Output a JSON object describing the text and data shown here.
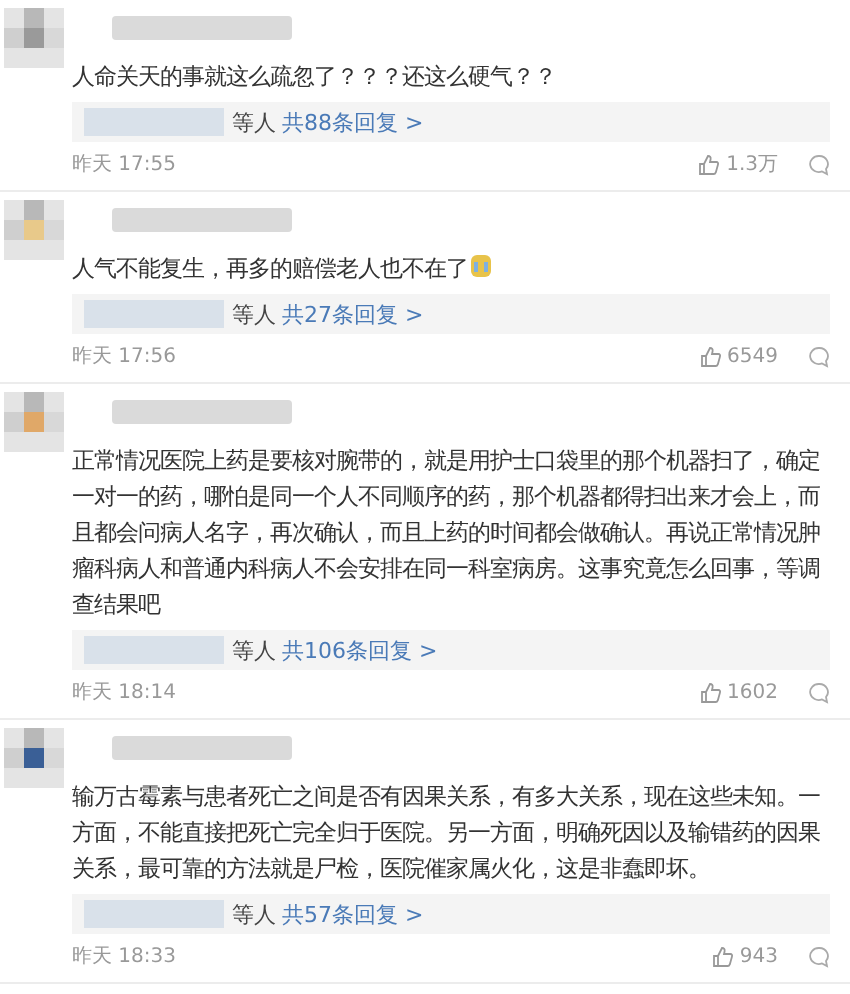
{
  "comments": [
    {
      "text": "人命关天的事就这么疏忽了？？？还这么硬气？？",
      "emoji": false,
      "reply_suffix": "等人",
      "reply_link": "共88条回复 >",
      "time": "昨天 17:55",
      "likes": "1.3万"
    },
    {
      "text": "人气不能复生，再多的赔偿老人也不在了",
      "emoji": true,
      "reply_suffix": "等人",
      "reply_link": "共27条回复 >",
      "time": "昨天 17:56",
      "likes": "6549"
    },
    {
      "text": "正常情况医院上药是要核对腕带的，就是用护士口袋里的那个机器扫了，确定一对一的药，哪怕是同一个人不同顺序的药，那个机器都得扫出来才会上，而且都会问病人名字，再次确认，而且上药的时间都会做确认。再说正常情况肿瘤科病人和普通内科病人不会安排在同一科室病房。这事究竟怎么回事，等调查结果吧",
      "emoji": false,
      "reply_suffix": "等人",
      "reply_link": "共106条回复 >",
      "time": "昨天 18:14",
      "likes": "1602"
    },
    {
      "text": "输万古霉素与患者死亡之间是否有因果关系，有多大关系，现在这些未知。一方面，不能直接把死亡完全归于医院。另一方面，明确死因以及输错药的因果关系，最可靠的方法就是尸检，医院催家属火化，这是非蠢即坏。",
      "emoji": false,
      "reply_suffix": "等人",
      "reply_link": "共57条回复 >",
      "time": "昨天 18:33",
      "likes": "943"
    }
  ]
}
